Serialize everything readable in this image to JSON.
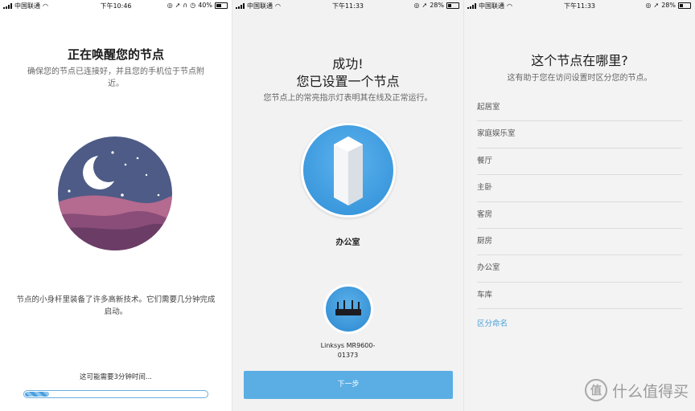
{
  "panels": [
    {
      "status": {
        "carrier": "中国联通",
        "time": "下午10:46",
        "battery": "40%"
      },
      "title": "正在唤醒您的节点",
      "subtitle_line1": "确保您的节点已连接好，并且您的手机位于节点附",
      "subtitle_line2": "近。",
      "body_line1": "节点的小身杆里装备了许多高新技术。它们需要几分钟完成",
      "body_line2": "启动。",
      "wait_text": "这可能需要3分钟时间...",
      "progress_fraction": 0.14
    },
    {
      "status": {
        "carrier": "中国联通",
        "time": "下午11:33",
        "battery": "28%"
      },
      "title_line1": "成功!",
      "title_line2": "您已设置一个节点",
      "subtitle": "您节点上的常亮指示灯表明其在线及正常运行。",
      "node_label": "办公室",
      "router_label_line1": "Linksys MR9600-",
      "router_label_line2": "01373",
      "next_button": "下一步"
    },
    {
      "status": {
        "carrier": "中国联通",
        "time": "下午11:33",
        "battery": "28%"
      },
      "title": "这个节点在哪里?",
      "subtitle": "这有助于您在访问设置时区分您的节点。",
      "locations": [
        "起居室",
        "家庭娱乐室",
        "餐厅",
        "主卧",
        "客房",
        "厨房",
        "办公室",
        "车库"
      ],
      "custom_name_link": "区分命名",
      "watermark": "什么值得买",
      "watermark_badge": "值"
    }
  ],
  "colors": {
    "accent": "#5aaee3",
    "link": "#4a9fd9",
    "moon_sky": "#4d5b86",
    "moon_hills": "#b56a90"
  }
}
